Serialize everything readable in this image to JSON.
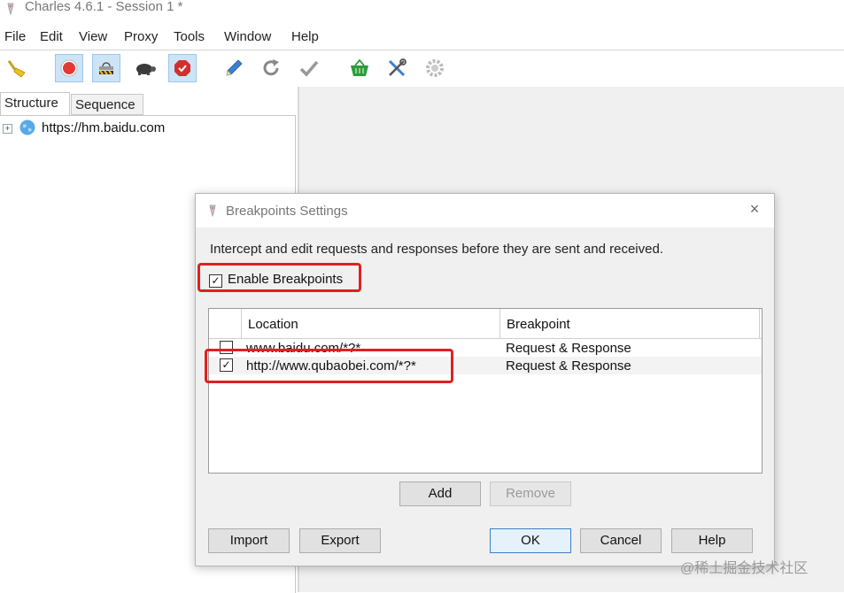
{
  "window": {
    "title": "Charles 4.6.1 - Session 1 *"
  },
  "menu": [
    "File",
    "Edit",
    "View",
    "Proxy",
    "Tools",
    "Window",
    "Help"
  ],
  "toolbar": {
    "buttons": [
      {
        "icon": "broom-icon",
        "active": false
      },
      {
        "icon": "record-icon",
        "active": true
      },
      {
        "icon": "throttle-icon",
        "active": true
      },
      {
        "icon": "turtle-icon",
        "active": false
      },
      {
        "icon": "breakpoint-stop-icon",
        "active": true
      },
      {
        "icon": "compose-pen-icon",
        "active": false
      },
      {
        "icon": "repeat-icon",
        "active": false
      },
      {
        "icon": "validate-check-icon",
        "active": false
      },
      {
        "icon": "basket-icon",
        "active": false
      },
      {
        "icon": "tools-icon",
        "active": false
      },
      {
        "icon": "settings-gear-icon",
        "active": false
      }
    ]
  },
  "tabs": {
    "structure": "Structure",
    "sequence": "Sequence"
  },
  "tree": {
    "host": "https://hm.baidu.com",
    "expander": "+"
  },
  "dialog": {
    "title": "Breakpoints Settings",
    "close": "×",
    "description": "Intercept and edit requests and responses before they are sent and received.",
    "enable_label": "Enable Breakpoints",
    "enable_checked": "✓",
    "columns": {
      "location": "Location",
      "breakpoint": "Breakpoint"
    },
    "rows": [
      {
        "checked": "",
        "location": "www.baidu.com/*?*",
        "breakpoint": "Request & Response"
      },
      {
        "checked": "✓",
        "location": "http://www.qubaobei.com/*?*",
        "breakpoint": "Request & Response"
      }
    ],
    "buttons": {
      "add": "Add",
      "remove": "Remove",
      "import": "Import",
      "export": "Export",
      "ok": "OK",
      "cancel": "Cancel",
      "help": "Help"
    }
  },
  "watermark": "@稀土掘金技术社区",
  "colors": {
    "highlight": "#e02020",
    "record": "#e53935",
    "stop": "#d32f2f",
    "basket": "#2e9b3a"
  }
}
